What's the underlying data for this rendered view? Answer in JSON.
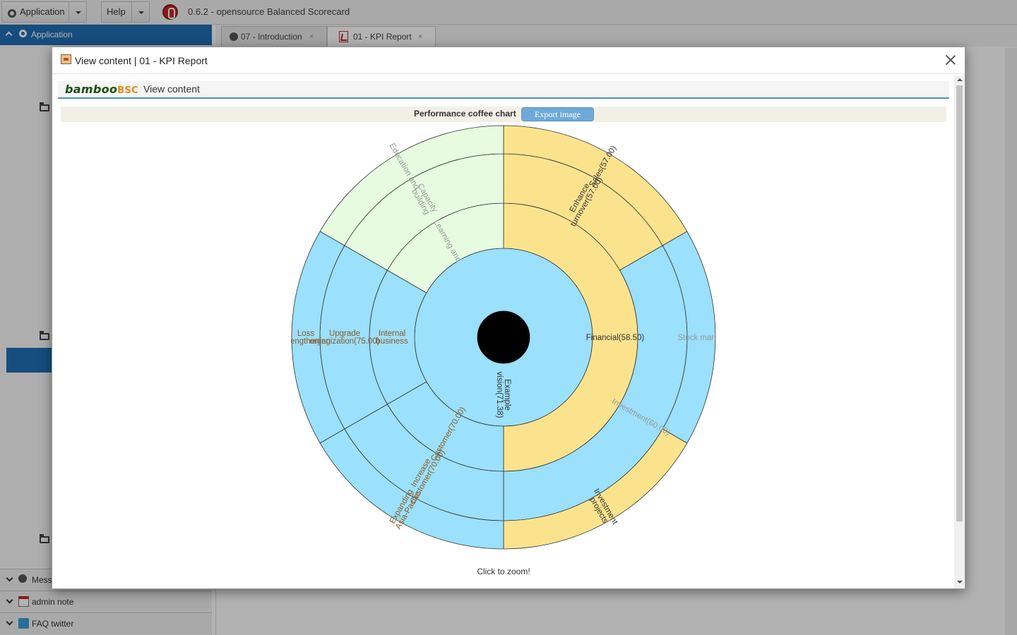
{
  "topbar": {
    "application_label": "Application",
    "help_label": "Help",
    "app_title": "0.6.2 - opensource Balanced Scorecard"
  },
  "leftpane": {
    "header_label": "Application",
    "accordion": [
      {
        "label": "Mess",
        "icon": "message-icon"
      },
      {
        "label": "admin note",
        "icon": "calendar-icon"
      },
      {
        "label": "FAQ twitter",
        "icon": "twitter-icon"
      }
    ]
  },
  "tabs": [
    {
      "label": "07 - Introduction",
      "close": "×",
      "icon": "message-icon",
      "active": false
    },
    {
      "label": "01 - KPI Report",
      "close": "×",
      "icon": "pdf-icon",
      "active": true
    }
  ],
  "modal": {
    "title": "View content | 01 - KPI Report",
    "logo_part1": "bamboo",
    "logo_part2": "BSC",
    "view_label": "View content",
    "chart_title": "Performance coffee chart",
    "export_label": "Export image",
    "zoom_hint": "Click to zoom!"
  },
  "chart_data": {
    "type": "sunburst",
    "title": "Performance coffee chart",
    "center_label": "",
    "colors": {
      "yellow": "#fbe38e",
      "blue": "#9be0fc",
      "green": "#e6fbe0",
      "center": "#000000"
    },
    "rings": [
      {
        "level": "vision",
        "segments": [
          {
            "label": "Example vision(71.38)",
            "start": 0,
            "end": 360,
            "color": "#9be0fc",
            "text_color": "#333333"
          }
        ]
      },
      {
        "level": "perspective",
        "segments": [
          {
            "label": "Financial(58.50)",
            "start": 0,
            "end": 180,
            "color": "#fbe38e",
            "text_color": "#333333"
          },
          {
            "label": "Customer(70.00)",
            "start": 180,
            "end": 240,
            "color": "#9be0fc",
            "text_color": "#8b5a2b"
          },
          {
            "label": "Internal business",
            "start": 240,
            "end": 300,
            "color": "#9be0fc",
            "text_color": "#8b5a2b"
          },
          {
            "label": "Learning and",
            "start": 300,
            "end": 360,
            "color": "#e6fbe0",
            "text_color": "#999999"
          }
        ]
      },
      {
        "level": "objective",
        "segments": [
          {
            "label": "Enhance turnover(57.00)",
            "start": 0,
            "end": 60,
            "color": "#fbe38e",
            "text_color": "#333333"
          },
          {
            "label": "Investment(60.00)",
            "start": 60,
            "end": 180,
            "color": "#9be0fc",
            "text_color": "#999999"
          },
          {
            "label": "Increase Customer(70.00)",
            "start": 180,
            "end": 240,
            "color": "#9be0fc",
            "text_color": "#8b5a2b"
          },
          {
            "label": "Upgrade organization(75.00)",
            "start": 240,
            "end": 300,
            "color": "#9be0fc",
            "text_color": "#8b5a2b"
          },
          {
            "label": "Capacity building",
            "start": 300,
            "end": 360,
            "color": "#e6fbe0",
            "text_color": "#999999"
          }
        ]
      },
      {
        "level": "kpi",
        "segments": [
          {
            "label": "Sales(57.00)",
            "start": 0,
            "end": 60,
            "color": "#fbe38e",
            "text_color": "#333333"
          },
          {
            "label": "Stock market",
            "start": 60,
            "end": 120,
            "color": "#9be0fc",
            "text_color": "#999999"
          },
          {
            "label": "Investment projects",
            "start": 120,
            "end": 180,
            "color": "#fbe38e",
            "text_color": "#333333"
          },
          {
            "label": "Expanding Asia-Pacific",
            "start": 180,
            "end": 240,
            "color": "#9be0fc",
            "text_color": "#8b5a2b"
          },
          {
            "label": "Loss strengthening",
            "start": 240,
            "end": 300,
            "color": "#9be0fc",
            "text_color": "#8b5a2b"
          },
          {
            "label": "Education and",
            "start": 300,
            "end": 360,
            "color": "#e6fbe0",
            "text_color": "#999999"
          }
        ]
      }
    ]
  }
}
